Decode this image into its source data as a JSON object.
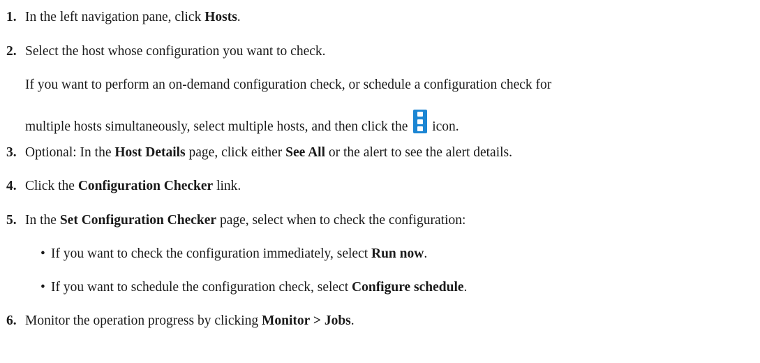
{
  "steps": [
    {
      "num": "1.",
      "parts": [
        "In the left navigation pane, click ",
        "Hosts",
        "."
      ]
    },
    {
      "num": "2.",
      "text": "Select the host whose configuration you want to check.",
      "para1": "If you want to perform an on-demand configuration check, or schedule a configuration check for",
      "para2_before": "multiple hosts simultaneously, select multiple hosts, and then click the ",
      "para2_after": " icon.",
      "icon": "kebab-menu-icon"
    },
    {
      "num": "3.",
      "parts": [
        "Optional: In the ",
        "Host Details",
        " page, click either ",
        "See All",
        " or the alert to see the alert details."
      ]
    },
    {
      "num": "4.",
      "parts": [
        "Click the ",
        "Configuration Checker",
        " link."
      ]
    },
    {
      "num": "5.",
      "parts": [
        "In the ",
        "Set Configuration Checker",
        " page, select when to check the configuration:"
      ],
      "bullets": [
        {
          "parts": [
            "If you want to check the configuration immediately, select ",
            "Run now",
            "."
          ]
        },
        {
          "parts": [
            "If you want to schedule the configuration check, select ",
            "Configure schedule",
            "."
          ]
        }
      ]
    },
    {
      "num": "6.",
      "parts": [
        "Monitor the operation progress by clicking ",
        "Monitor > Jobs",
        "."
      ]
    }
  ],
  "bullet_char": "•",
  "colors": {
    "icon_bg": "#1c86d3",
    "text": "#1a1a1a"
  }
}
